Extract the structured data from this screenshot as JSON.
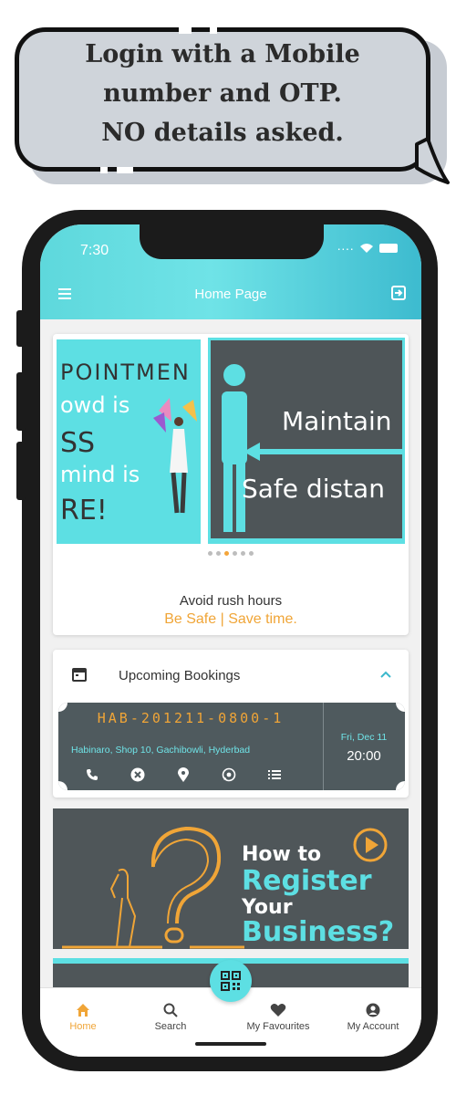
{
  "bubble": {
    "line1": "Login with a Mobile",
    "line2": "number and OTP.",
    "line3": "NO details asked."
  },
  "status_bar": {
    "time": "7:30"
  },
  "appbar": {
    "title": "Home Page"
  },
  "carousel": {
    "slide1_lines": [
      "POINTMEN",
      "owd is",
      "SS",
      "mind is",
      "RE!"
    ],
    "slide2_lines": [
      "Maintain",
      "Safe distan"
    ],
    "dots_total": 6,
    "dot_active_index": 2,
    "caption": "Avoid rush hours",
    "tagline": "Be Safe | Save time."
  },
  "bookings": {
    "title": "Upcoming Bookings",
    "ticket": {
      "code": "HAB-201211-0800-1",
      "address": "Habinaro, Shop 10, Gachibowli, Hyderbad",
      "date": "Fri, Dec 11",
      "time": "20:00",
      "actions": [
        "phone-icon",
        "cancel-icon",
        "location-icon",
        "whatsapp-icon",
        "list-icon"
      ]
    }
  },
  "banner": {
    "line1": "How to",
    "line2": "Register",
    "line3": "Your",
    "line4": "Business?"
  },
  "bottom_nav": {
    "items": [
      {
        "label": "Home",
        "icon": "home-icon",
        "active": true
      },
      {
        "label": "Search",
        "icon": "search-icon"
      },
      {
        "label": "My Favourites",
        "icon": "heart-icon"
      },
      {
        "label": "My Account",
        "icon": "account-icon"
      }
    ],
    "fab_icon": "qr-code-icon"
  },
  "colors": {
    "accent": "#5ddfe3",
    "orange": "#f0a537",
    "dark": "#4f5659"
  }
}
